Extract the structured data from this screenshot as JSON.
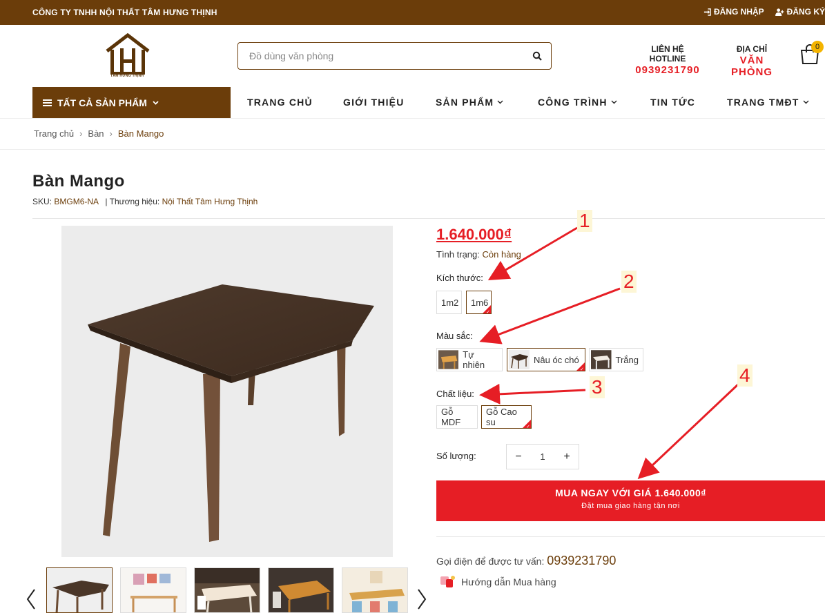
{
  "topbar": {
    "company": "CÔNG TY TNHH NỘI THẤT TÂM HƯNG THỊNH",
    "login": "ĐĂNG NHẬP",
    "register": "ĐĂNG KÝ"
  },
  "header": {
    "logo_text": "TÂM HƯNG THỊNH",
    "search_placeholder": "Đồ dùng văn phòng",
    "hotline_label": "LIÊN HỆ HOTLINE",
    "hotline_value": "0939231790",
    "address_label": "ĐỊA CHỈ",
    "address_value": "VĂN PHÒNG",
    "cart_count": "0"
  },
  "nav": {
    "all_products": "TẤT CẢ SẢN PHẨM",
    "items": [
      "TRANG CHỦ",
      "GIỚI THIỆU",
      "SẢN PHẨM",
      "CÔNG TRÌNH",
      "TIN TỨC",
      "TRANG TMĐT"
    ]
  },
  "breadcrumb": [
    "Trang chủ",
    "Bàn",
    "Bàn Mango"
  ],
  "product": {
    "title": "Bàn Mango",
    "sku_label": "SKU:",
    "sku": "BMGM6-NA",
    "brand_label": "| Thương hiệu:",
    "brand": "Nội Thất Tâm Hưng Thịnh",
    "price": "1.640.000₫",
    "status_label": "Tình trạng:",
    "status": "Còn hàng",
    "size_label": "Kích thước:",
    "sizes": [
      "1m2",
      "1m6"
    ],
    "size_selected": "1m6",
    "color_label": "Màu sắc:",
    "colors": [
      "Tự nhiên",
      "Nâu óc chó",
      "Trắng"
    ],
    "color_selected": "Nâu óc chó",
    "material_label": "Chất liệu:",
    "materials": [
      "Gỗ MDF",
      "Gỗ Cao su"
    ],
    "material_selected": "Gỗ Cao su",
    "qty_label": "Số lượng:",
    "qty": "1",
    "buy_line1": "MUA NGAY VỚI GIÁ 1.640.000₫",
    "buy_line2": "Đặt mua giao hàng tận nơi",
    "call_label": "Gọi điện để được tư vấn:",
    "call_number": "0939231790",
    "guide": "Hướng dẫn Mua hàng"
  },
  "annotations": [
    "1",
    "2",
    "3",
    "4"
  ],
  "colors": {
    "brand": "#6b3d0a",
    "accent": "#e61e25",
    "badge": "#f4b400"
  }
}
